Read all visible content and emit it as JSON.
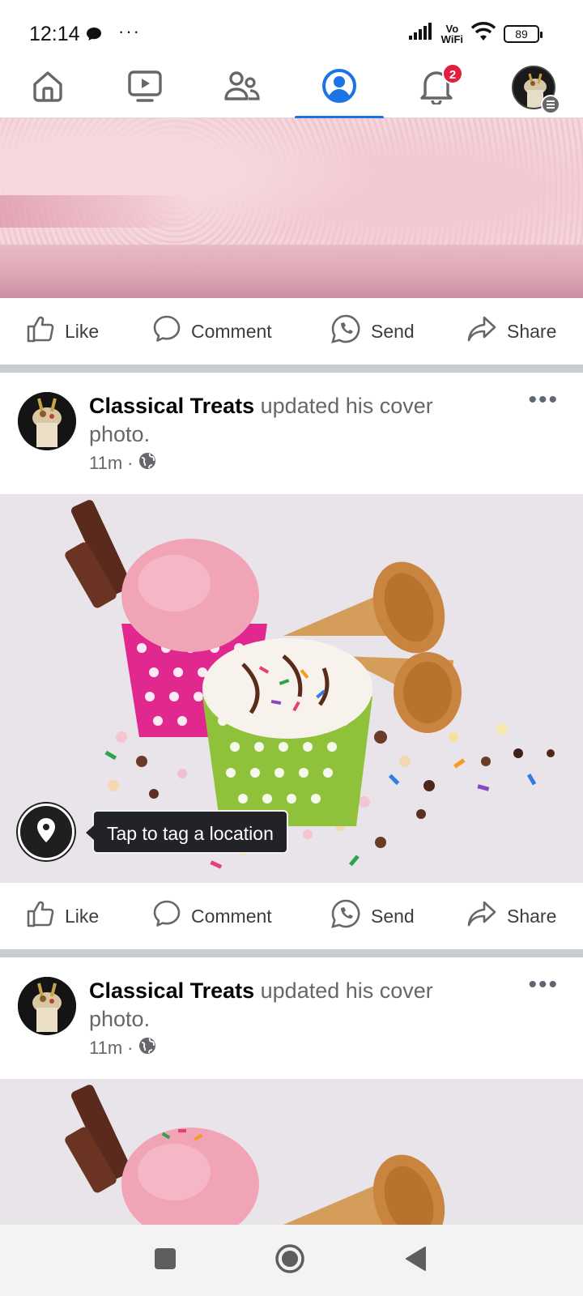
{
  "status_bar": {
    "time": "12:14",
    "more": "···",
    "volte_line1": "Vo",
    "volte_line2": "WiFi",
    "battery": "89"
  },
  "nav": {
    "tabs": [
      {
        "name": "home",
        "icon": "home-icon"
      },
      {
        "name": "watch",
        "icon": "video-icon"
      },
      {
        "name": "friends",
        "icon": "friends-icon"
      },
      {
        "name": "profile",
        "icon": "profile-icon",
        "active": true
      },
      {
        "name": "notifications",
        "icon": "bell-icon",
        "badge": "2"
      },
      {
        "name": "menu",
        "icon": "menu-icon"
      }
    ]
  },
  "actions": {
    "like": "Like",
    "comment": "Comment",
    "send": "Send",
    "share": "Share"
  },
  "posts": [
    {
      "author": "Classical Treats",
      "action_text": " updated his cover photo.",
      "time": "11m",
      "separator": "·",
      "privacy_icon": "globe-icon",
      "more": "•••",
      "location_tip": "Tap to tag a location"
    },
    {
      "author": "Classical Treats",
      "action_text": " updated his cover photo.",
      "time": "11m",
      "separator": "·",
      "privacy_icon": "globe-icon",
      "more": "•••"
    }
  ],
  "colors": {
    "accent": "#1b74e4",
    "badge": "#e41e3f",
    "text_secondary": "#65676b"
  }
}
